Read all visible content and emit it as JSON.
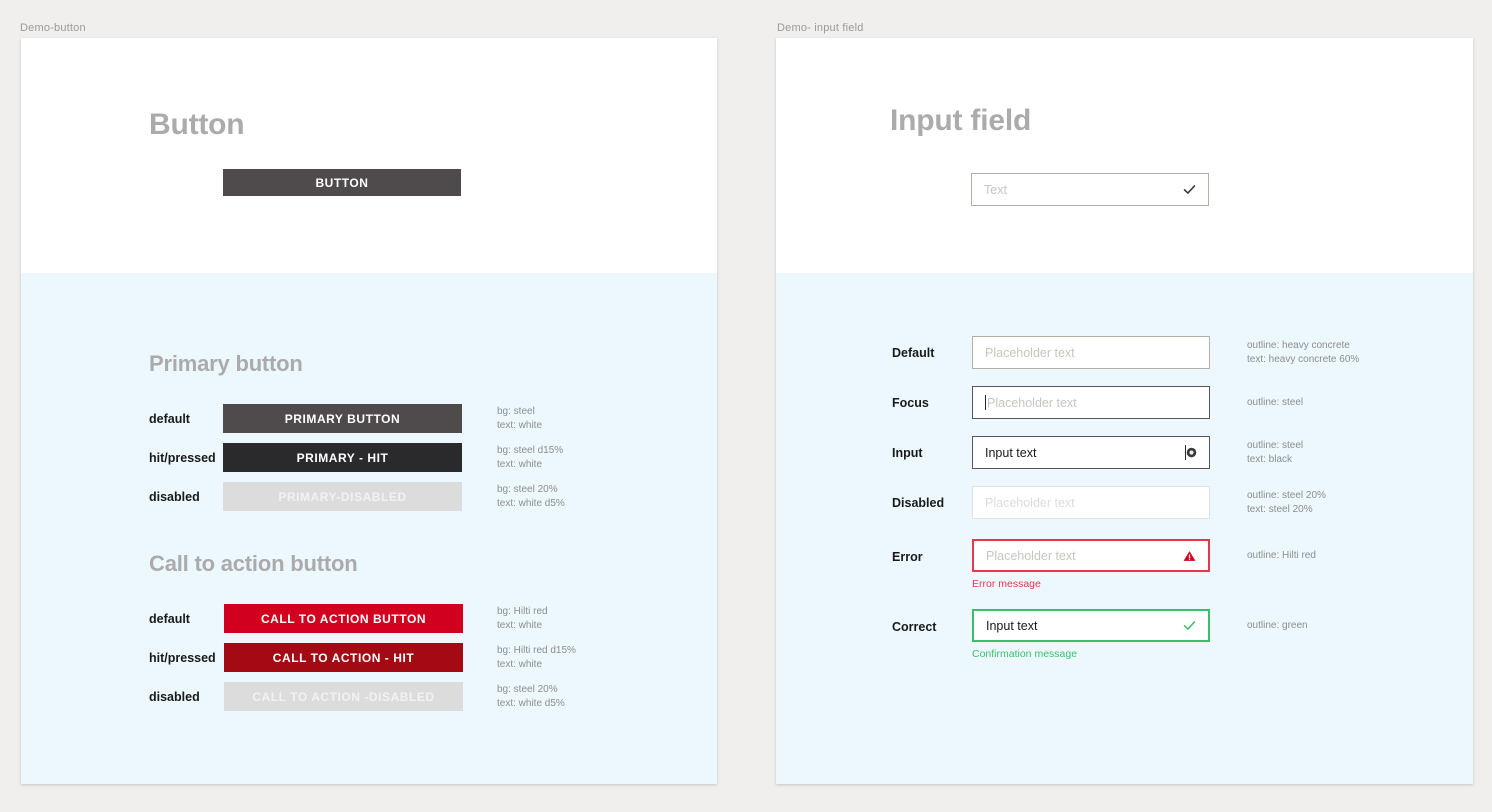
{
  "frames": {
    "left_label": "Demo-button",
    "right_label": "Demo- input field"
  },
  "button_panel": {
    "hero_title": "Button",
    "hero_button_label": "BUTTON",
    "sections": [
      {
        "title": "Primary button",
        "rows": [
          {
            "state": "default",
            "label": "PRIMARY BUTTON",
            "annotation": "bg: steel\ntext: white"
          },
          {
            "state": "hit/pressed",
            "label": "PRIMARY - HIT",
            "annotation": "bg: steel d15%\ntext: white"
          },
          {
            "state": "disabled",
            "label": "PRIMARY-DISABLED",
            "annotation": "bg: steel 20%\ntext: white d5%"
          }
        ]
      },
      {
        "title": "Call to action button",
        "rows": [
          {
            "state": "default",
            "label": "CALL TO ACTION BUTTON",
            "annotation": "bg: Hilti red\ntext: white"
          },
          {
            "state": "hit/pressed",
            "label": "CALL TO ACTION - HIT",
            "annotation": "bg: Hilti red d15%\ntext: white"
          },
          {
            "state": "disabled",
            "label": "CALL TO ACTION -DISABLED",
            "annotation": "bg: steel 20%\ntext: white d5%"
          }
        ]
      }
    ]
  },
  "input_panel": {
    "hero_title": "Input field",
    "hero_field": {
      "placeholder": "Text",
      "value": "",
      "icon": "check-icon"
    },
    "rows": [
      {
        "state": "Default",
        "placeholder": "Placeholder text",
        "value": "",
        "icon": "",
        "annotation": "outline: heavy concrete\ntext: heavy concrete 60%",
        "message": ""
      },
      {
        "state": "Focus",
        "placeholder": "Placeholder text",
        "value": "",
        "icon": "",
        "annotation": "outline: steel",
        "message": ""
      },
      {
        "state": "Input",
        "placeholder": "",
        "value": "Input text",
        "icon": "clear-circle-icon",
        "annotation": "outline: steel\ntext: black",
        "message": ""
      },
      {
        "state": "Disabled",
        "placeholder": "Placeholder text",
        "value": "",
        "icon": "",
        "annotation": "outline: steel 20%\ntext: steel 20%",
        "message": ""
      },
      {
        "state": "Error",
        "placeholder": "Placeholder text",
        "value": "",
        "icon": "warning-triangle-icon",
        "annotation": "outline: Hilti red",
        "message": "Error message"
      },
      {
        "state": "Correct",
        "placeholder": "",
        "value": "Input text",
        "icon": "check-icon",
        "annotation": "outline: green",
        "message": "Confirmation message"
      }
    ]
  },
  "colors": {
    "page_bg": "#F0EFEE",
    "panel_blue": "#ECF8FD",
    "steel": "#4F4B4D",
    "steel_d15": "#2A292B",
    "steel_20": "#DCDCDC",
    "hilti_red": "#D2001E",
    "hilti_red_d15": "#A40A14",
    "heavy_concrete": "#B4AFA3",
    "green": "#3DBE6B",
    "error_red": "#E8374A",
    "heading_gray": "#ABABAB"
  }
}
